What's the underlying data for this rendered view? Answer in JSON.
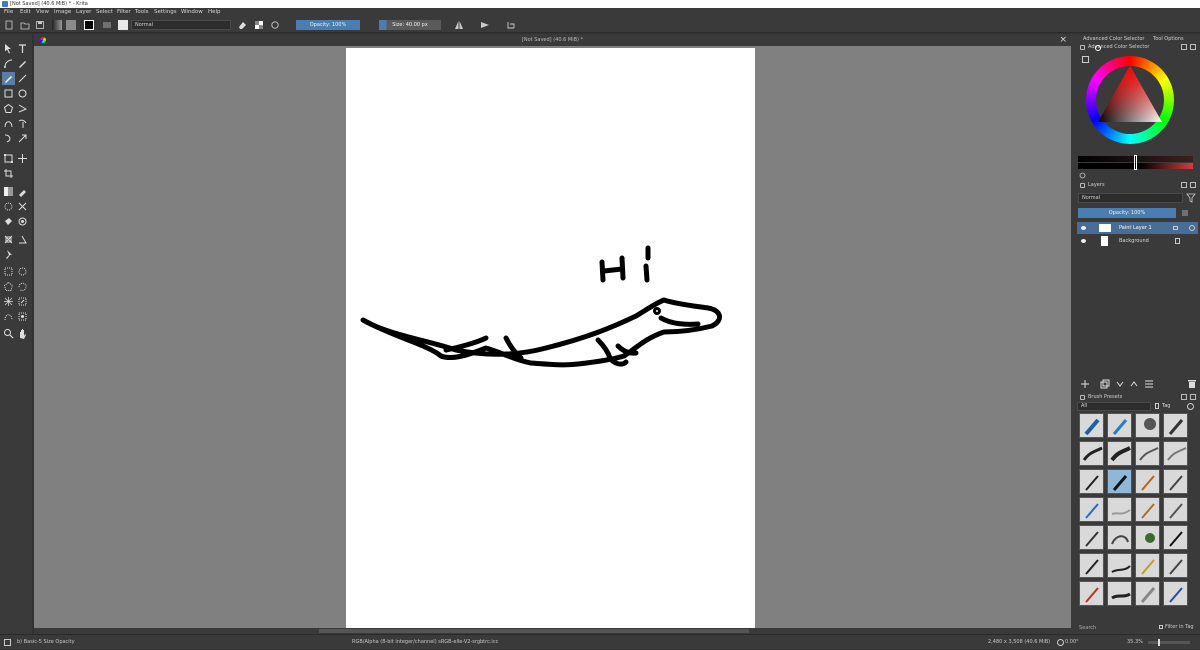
{
  "window": {
    "title": "[Not Saved]  (40.6 MiB)  * - Krita"
  },
  "menu": [
    "File",
    "Edit",
    "View",
    "Image",
    "Layer",
    "Select",
    "Filter",
    "Tools",
    "Settings",
    "Window",
    "Help"
  ],
  "toolbar": {
    "blend_mode": "Normal",
    "opacity_label": "Opacity: 100%",
    "size_label": "Size: 40.00 px"
  },
  "document": {
    "tab_title": "[Not Saved]  (40.6 MiB) *"
  },
  "canvas": {
    "drawing_text": "Hi"
  },
  "dock": {
    "color_tabs": [
      "Advanced Color Selector",
      "Tool Options"
    ],
    "color_panel_title": "Advanced Color Selector",
    "layers_title": "Layers",
    "layers_blend": "Normal",
    "layers_opacity": "Opacity: 100%",
    "layers": [
      {
        "name": "Paint Layer 1"
      },
      {
        "name": "Background"
      }
    ],
    "brush_title": "Brush Presets",
    "brush_filter": "All",
    "brush_tag": "Tag",
    "search_placeholder": "Search",
    "filter_in_tag": "Filter in Tag"
  },
  "status": {
    "brush": "b) Basic-5 Size Opacity",
    "color_info": "RGB/Alpha (8-bit integer/channel)  sRGB-elle-V2-srgbtrc.icc",
    "dimensions": "2,480 x 3,508 (40.6 MiB)",
    "rotation": "0.00°",
    "zoom": "35.3%"
  },
  "colors": {
    "accent": "#4a7eb0",
    "panel": "#3a3a3a",
    "canvas_bg": "#808080"
  }
}
